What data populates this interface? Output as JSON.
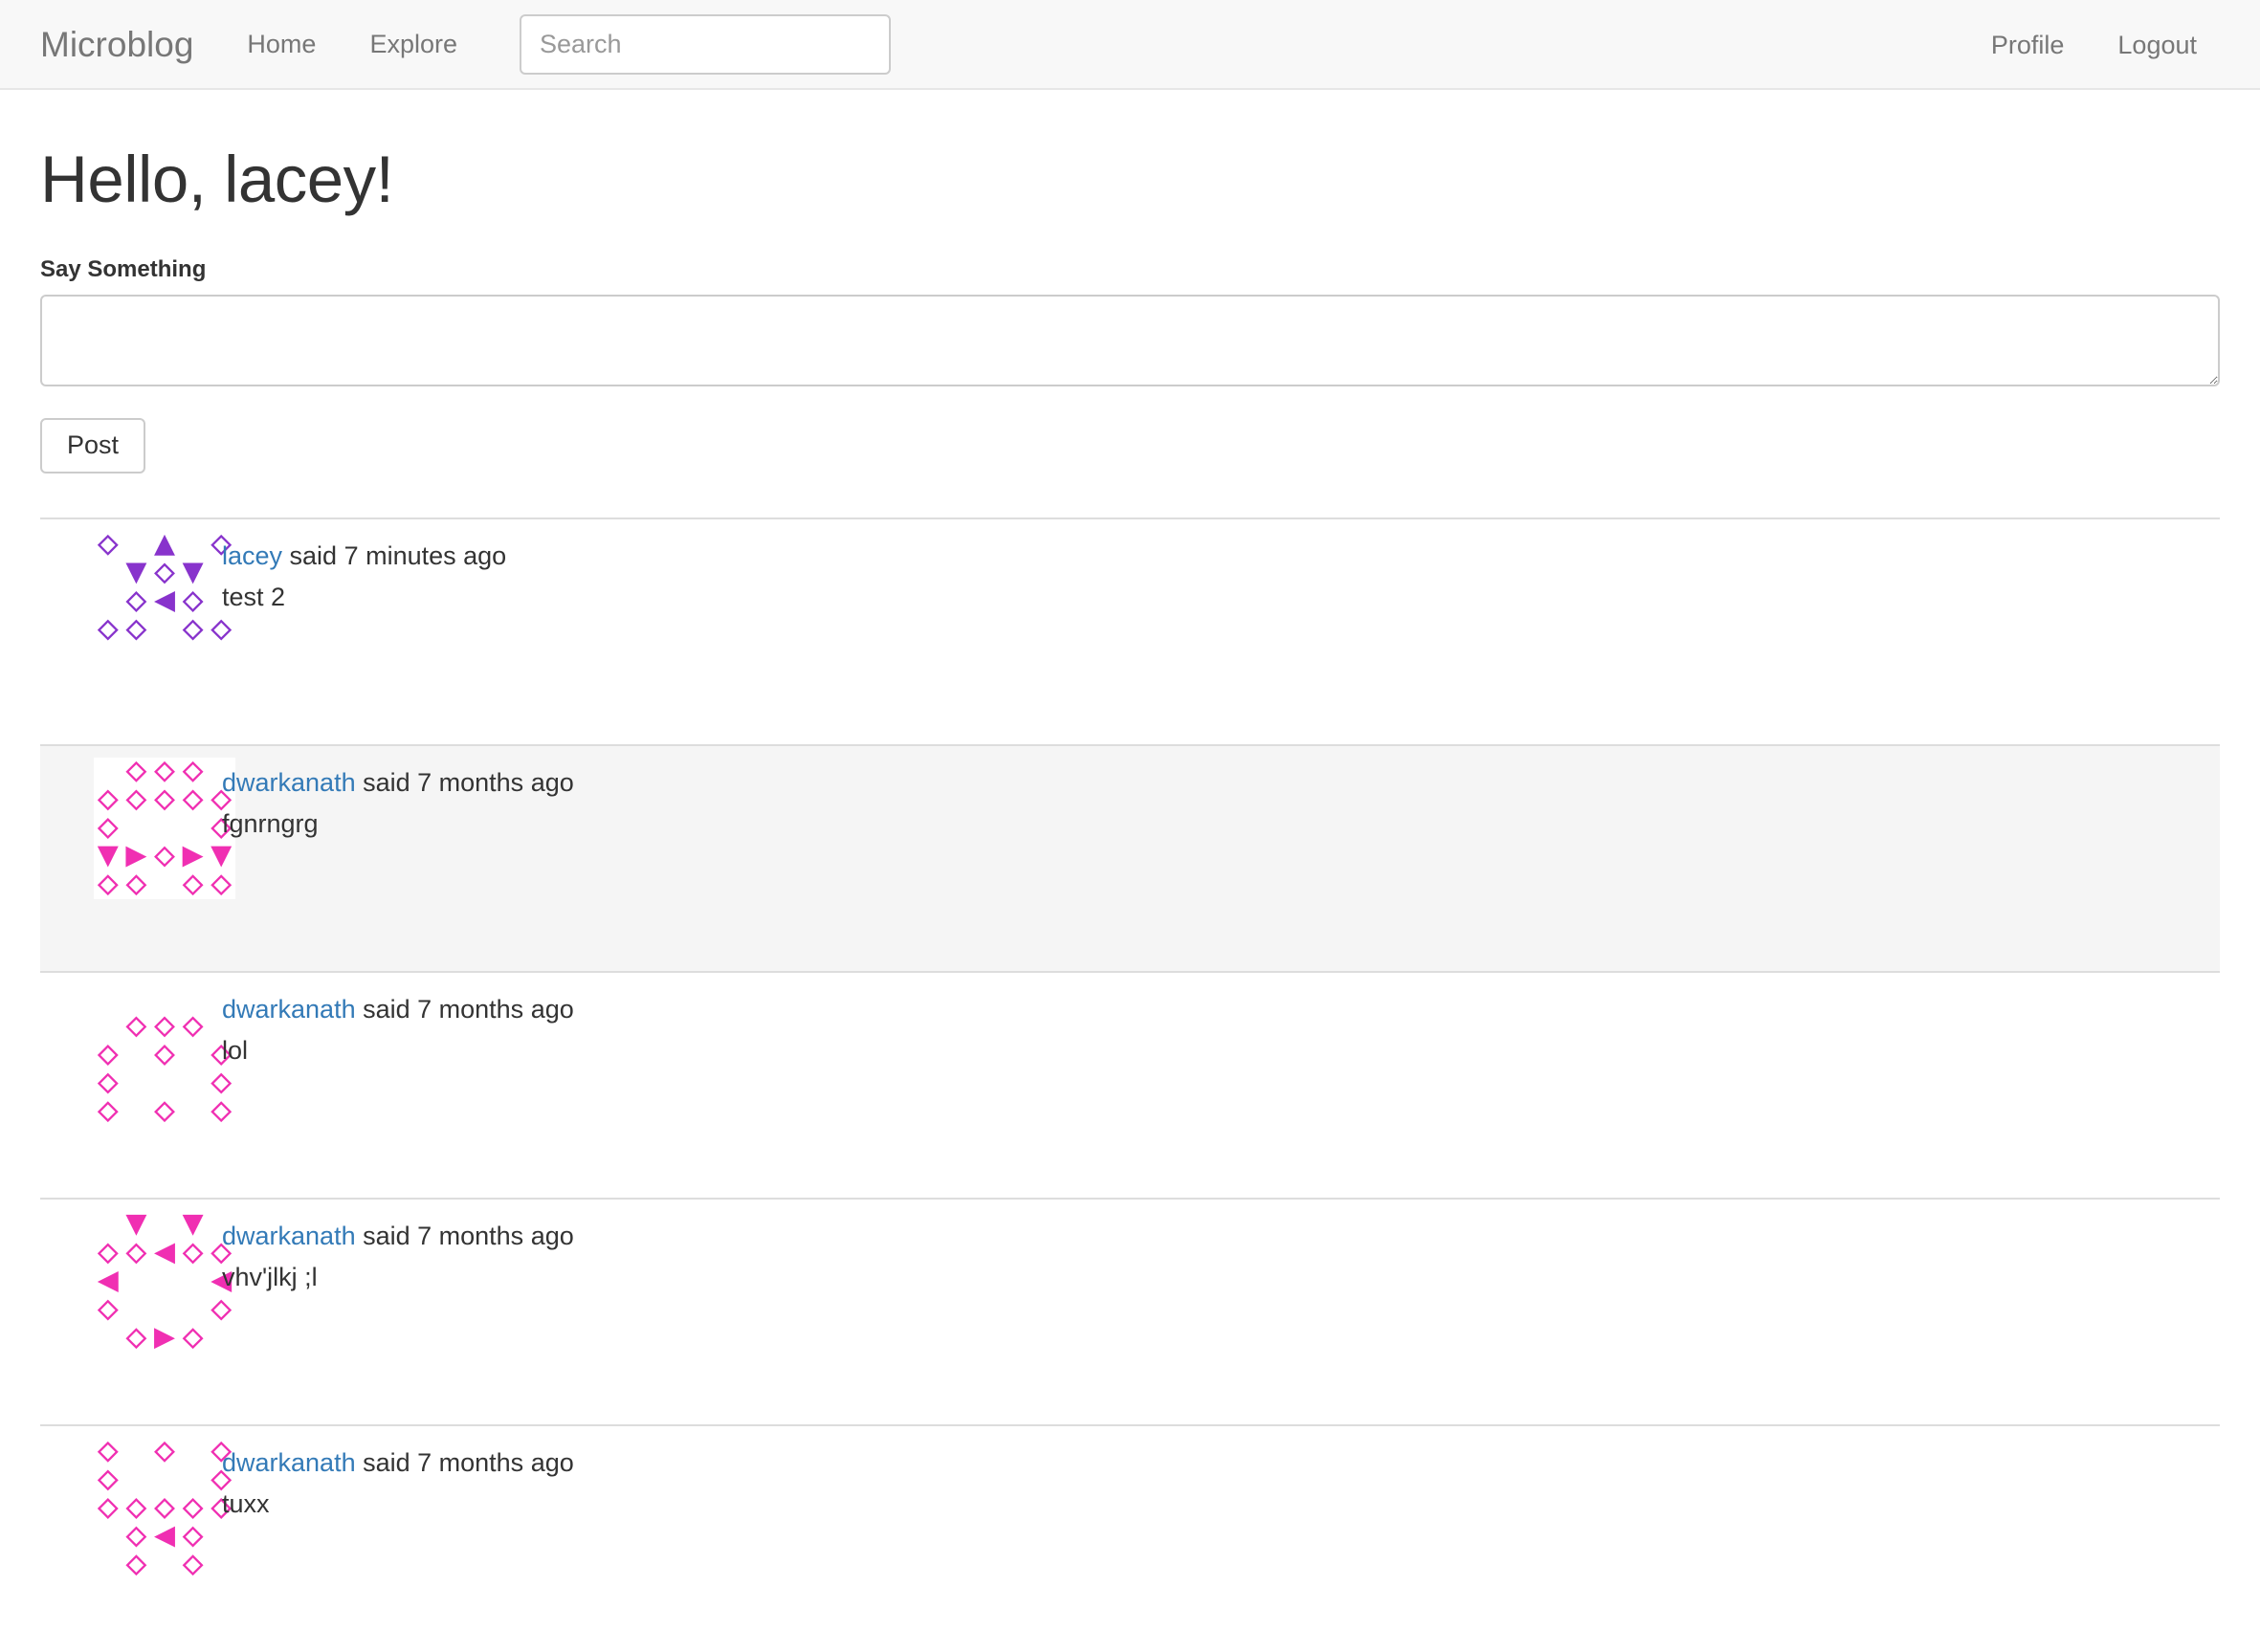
{
  "navbar": {
    "brand": "Microblog",
    "links": [
      {
        "label": "Home",
        "name": "nav-link-home"
      },
      {
        "label": "Explore",
        "name": "nav-link-explore"
      }
    ],
    "search": {
      "placeholder": "Search",
      "value": ""
    },
    "right_links": [
      {
        "label": "Profile",
        "name": "nav-link-profile"
      },
      {
        "label": "Logout",
        "name": "nav-link-logout"
      }
    ],
    "background_color": "#f8f8f8",
    "border_color": "#e7e7e7",
    "text_color": "#777777"
  },
  "main": {
    "greeting": "Hello, lacey!",
    "form": {
      "label": "Say Something",
      "textarea_value": "",
      "textarea_placeholder": "",
      "submit_label": "Post"
    }
  },
  "posts": [
    {
      "author": "lacey",
      "said": "said",
      "timestamp": "7 minutes ago",
      "body": "test 2",
      "avatar_color": "#8833cc",
      "avatar_seed": "lacey",
      "highlighted": false
    },
    {
      "author": "dwarkanath",
      "said": "said",
      "timestamp": "7 months ago",
      "body": "fgnrngrg",
      "avatar_color": "#f02fb2",
      "avatar_seed": "dwarkanath",
      "highlighted": true
    },
    {
      "author": "dwarkanath",
      "said": "said",
      "timestamp": "7 months ago",
      "body": "lol",
      "avatar_color": "#f02fb2",
      "avatar_seed": "dwarkanath",
      "highlighted": false
    },
    {
      "author": "dwarkanath",
      "said": "said",
      "timestamp": "7 months ago",
      "body": "vhv'jlkj ;l",
      "avatar_color": "#f02fb2",
      "avatar_seed": "dwarkanath",
      "highlighted": false
    },
    {
      "author": "dwarkanath",
      "said": "said",
      "timestamp": "7 months ago",
      "body": "tuxx",
      "avatar_color": "#f02fb2",
      "avatar_seed": "dwarkanath",
      "highlighted": false
    }
  ],
  "colors": {
    "link": "#337ab7",
    "text": "#333333",
    "muted": "#777777",
    "divider": "#dddddd",
    "row_highlight": "#f5f5f5"
  }
}
